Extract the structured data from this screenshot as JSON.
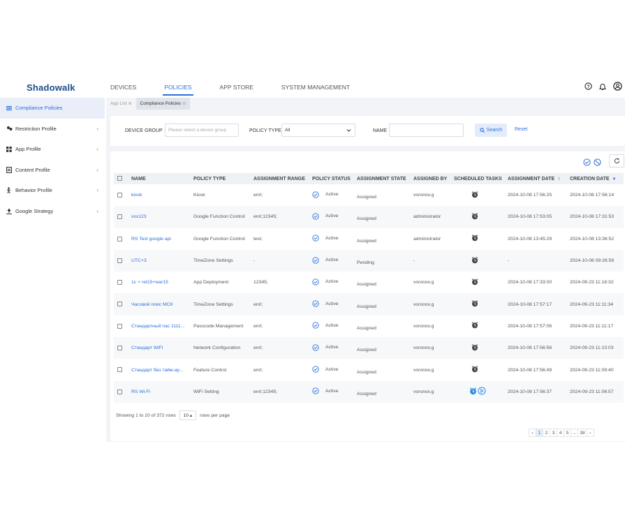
{
  "app": {
    "logo": "Shadowalk"
  },
  "topnav": [
    {
      "label": "DEVICES",
      "active": false
    },
    {
      "label": "POLICIES",
      "active": true
    },
    {
      "label": "APP STORE",
      "active": false
    },
    {
      "label": "SYSTEM MANAGEMENT",
      "active": false
    }
  ],
  "topicons": [
    "help-icon",
    "bell-icon",
    "user-avatar-icon"
  ],
  "sidebar": {
    "items": [
      {
        "label": "Compliance Policies",
        "icon": "list-icon",
        "active": true
      },
      {
        "label": "Restriction Profile",
        "icon": "restriction-icon",
        "active": false
      },
      {
        "label": "App Profile",
        "icon": "grid-icon",
        "active": false
      },
      {
        "label": "Content Profile",
        "icon": "document-icon",
        "active": false
      },
      {
        "label": "Behavior Profile",
        "icon": "person-icon",
        "active": false
      },
      {
        "label": "Google Strategy",
        "icon": "pin-icon",
        "active": false
      }
    ]
  },
  "tabs": [
    {
      "label": "App List",
      "active": false
    },
    {
      "label": "Compliance Policies",
      "active": true
    }
  ],
  "filters": {
    "device_group_label": "DEVICE GROUP",
    "device_group_placeholder": "Please select a device group",
    "policy_type_label": "POLICY TYPE",
    "policy_type_value": "All",
    "name_label": "NAME",
    "name_value": "",
    "search_label": "Search",
    "reset_label": "Reset"
  },
  "table": {
    "columns": [
      "NAME",
      "POLICY TYPE",
      "ASSIGNMENT RANGE",
      "POLICY STATUS",
      "ASSIGNMENT STATE",
      "ASSIGNED BY",
      "SCHEDULED TASKS",
      "ASSIGNMENT DATE",
      "CREATION DATE"
    ],
    "rows": [
      {
        "name": "kiosk",
        "policy_type": "Kiosk",
        "range": "enrl;",
        "status": "Active",
        "state": "Assigned",
        "by": "voronov.g",
        "tasks": "alarm",
        "assign_date": "2024-10-08 17:56:25",
        "created": "2024-10-08 17:56:14"
      },
      {
        "name": "xxx123",
        "policy_type": "Google Function Control",
        "range": "enrl;12345;",
        "status": "Active",
        "state": "Assigned",
        "by": "administrator",
        "tasks": "alarm",
        "assign_date": "2024-10-08 17:53:05",
        "created": "2024-10-08 17:31:53"
      },
      {
        "name": "RS Test google api",
        "policy_type": "Google Function Control",
        "range": "test;",
        "status": "Active",
        "state": "Assigned",
        "by": "administrator",
        "tasks": "alarm",
        "assign_date": "2024-10-08 13:45:29",
        "created": "2024-10-08 13:36:52"
      },
      {
        "name": "UTC+3",
        "policy_type": "TimeZone Settings",
        "range": "-",
        "status": "Active",
        "state": "Pending",
        "by": "-",
        "tasks": "alarm",
        "assign_date": "-",
        "created": "2024-10-06 09:26:58"
      },
      {
        "name": "1c + ret15+war15",
        "policy_type": "App Deployment",
        "range": "12345;",
        "status": "Active",
        "state": "Assigned",
        "by": "voronov.g",
        "tasks": "alarm",
        "assign_date": "2024-10-08 17:33:00",
        "created": "2024-09-23 11:16:32"
      },
      {
        "name": "Часовой пояс МСК",
        "policy_type": "TimeZone Settings",
        "range": "enrl;",
        "status": "Active",
        "state": "Assigned",
        "by": "voronov.g",
        "tasks": "alarm",
        "assign_date": "2024-10-08 17:57:17",
        "created": "2024-09-23 11:11:34"
      },
      {
        "name": "Стандартный пас 1111...",
        "policy_type": "Passcode Management",
        "range": "enrl;",
        "status": "Active",
        "state": "Assigned",
        "by": "voronov.g",
        "tasks": "alarm",
        "assign_date": "2024-10-08 17:57:06",
        "created": "2024-09-23 11:11:17"
      },
      {
        "name": "Стандарт WiFi",
        "policy_type": "Network Configuration",
        "range": "enrl;",
        "status": "Active",
        "state": "Assigned",
        "by": "voronov.g",
        "tasks": "alarm",
        "assign_date": "2024-10-08 17:56:56",
        "created": "2024-09-23 11:10:03"
      },
      {
        "name": "Стандарт без тайм-ау...",
        "policy_type": "Feature Control",
        "range": "enrl;",
        "status": "Active",
        "state": "Assigned",
        "by": "voronov.g",
        "tasks": "alarm",
        "assign_date": "2024-10-08 17:56:49",
        "created": "2024-09-23 11:09:40"
      },
      {
        "name": "RS Wi-Fi",
        "policy_type": "WiFi Setting",
        "range": "enrl;12345;",
        "status": "Active",
        "state": "Assigned",
        "by": "voronov.g",
        "tasks": "alarm-play",
        "assign_date": "2024-10-08 17:56:37",
        "created": "2024-09-23 11:06:57"
      }
    ]
  },
  "footer": {
    "showing": "Showing 1 to 10 of 372 rows",
    "rows_per_page_value": "10",
    "rows_per_page_label": "rows per page"
  },
  "pagination": {
    "pages": [
      "1",
      "2",
      "3",
      "4",
      "5",
      "...",
      "38"
    ],
    "current": "1",
    "prev": "‹",
    "next": "›"
  },
  "colors": {
    "accent": "#2b6fde",
    "brand": "#1f4e8c",
    "active_bg": "#e9eef9"
  }
}
